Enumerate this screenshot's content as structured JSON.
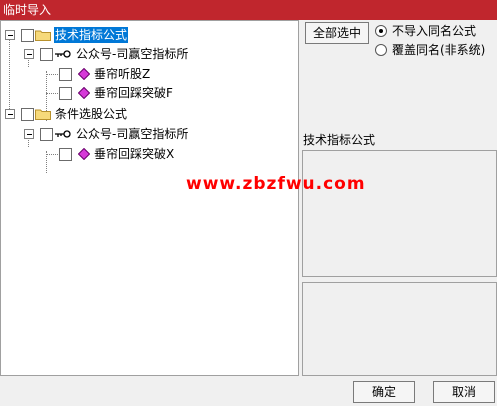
{
  "window": {
    "title": "临时导入"
  },
  "tree": {
    "nodes": [
      {
        "label": "技术指标公式",
        "kind": "folder",
        "level": 0,
        "selected": true
      },
      {
        "label": "公众号-司赢空指标所",
        "kind": "group",
        "level": 1
      },
      {
        "label": "垂帘听股Z",
        "kind": "formula",
        "level": 2
      },
      {
        "label": "垂帘回踩突破F",
        "kind": "formula",
        "level": 2
      },
      {
        "label": "条件选股公式",
        "kind": "folder",
        "level": 0
      },
      {
        "label": "公众号-司赢空指标所",
        "kind": "group",
        "level": 1
      },
      {
        "label": "垂帘回踩突破X",
        "kind": "formula",
        "level": 2
      }
    ]
  },
  "controls": {
    "select_all_label": "全部选中",
    "radio_options": [
      {
        "label": "不导入同名公式",
        "checked": true
      },
      {
        "label": "覆盖同名(非系统)",
        "checked": false
      }
    ],
    "info_label": "技术指标公式"
  },
  "watermark": "www.zbzfwu.com",
  "footer": {
    "ok_label": "确定",
    "cancel_label": "取消"
  },
  "colors": {
    "titlebar": "#c0262d",
    "selection": "#0078d7",
    "folder": "#f6d97a",
    "formula": "#d63ad8",
    "watermark": "#ff0000"
  }
}
